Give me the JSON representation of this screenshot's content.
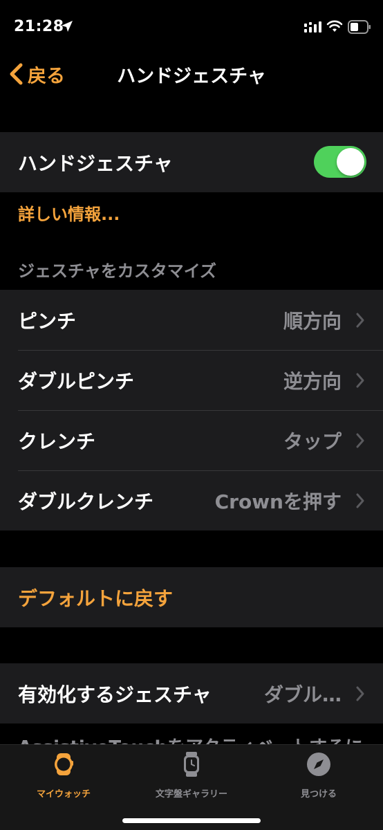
{
  "status": {
    "time": "21:28"
  },
  "nav": {
    "back_label": "戻る",
    "title": "ハンドジェスチャ"
  },
  "hand_gesture": {
    "label": "ハンドジェスチャ",
    "enabled": true
  },
  "learn_more": "詳しい情報...",
  "customize": {
    "header": "ジェスチャをカスタマイズ",
    "items": [
      {
        "label": "ピンチ",
        "value": "順方向"
      },
      {
        "label": "ダブルピンチ",
        "value": "逆方向"
      },
      {
        "label": "クレンチ",
        "value": "タップ"
      },
      {
        "label": "ダブルクレンチ",
        "value": "Crownを押す"
      }
    ]
  },
  "reset_label": "デフォルトに戻す",
  "activation": {
    "label": "有効化するジェスチャ",
    "value": "ダブル…"
  },
  "footer_text": "AssistiveTouchをアクティベートするに",
  "tabs": [
    {
      "label": "マイウォッチ",
      "icon": "watch-icon",
      "active": true
    },
    {
      "label": "文字盤ギャラリー",
      "icon": "watch-face-icon",
      "active": false
    },
    {
      "label": "見つける",
      "icon": "compass-icon",
      "active": false
    }
  ],
  "colors": {
    "accent": "#f4a33c",
    "toggle_on": "#4fd15b",
    "cell": "#1c1c1e",
    "secondary": "#8e8e93"
  }
}
